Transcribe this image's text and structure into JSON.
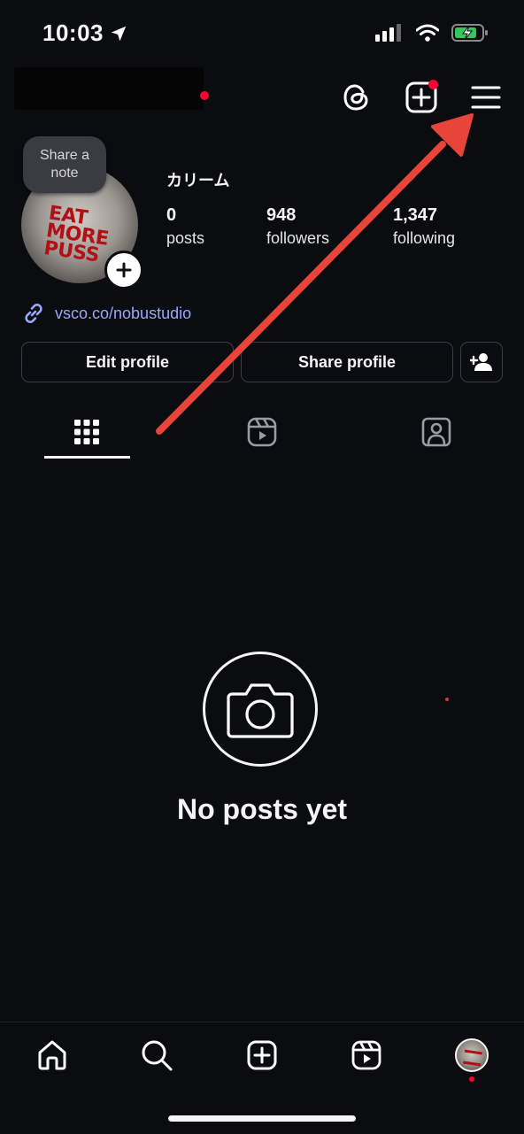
{
  "status_bar": {
    "time": "10:03",
    "icons": [
      "location-arrow-icon",
      "cellular-signal-icon",
      "wifi-icon",
      "battery-charging-icon"
    ]
  },
  "header": {
    "username": "",
    "icons": [
      "threads-icon",
      "create-icon",
      "menu-icon"
    ],
    "notification_color": "#ff0033"
  },
  "profile": {
    "note_bubble": [
      "Share a",
      "note"
    ],
    "avatar_text": [
      "EAT",
      "MORE",
      "PUSS"
    ],
    "display_name": "カリーム",
    "stats": [
      {
        "value": "0",
        "label": "posts"
      },
      {
        "value": "948",
        "label": "followers"
      },
      {
        "value": "1,347",
        "label": "following"
      }
    ],
    "link": "vsco.co/nobustudio",
    "buttons": {
      "edit": "Edit profile",
      "share": "Share profile"
    }
  },
  "tabs": [
    "grid-icon",
    "reels-icon",
    "tagged-icon"
  ],
  "empty_state": {
    "message": "No posts yet"
  },
  "bottom_nav": [
    "home-icon",
    "search-icon",
    "create-icon",
    "reels-icon",
    "profile-avatar"
  ],
  "colors": {
    "background": "#0b0c10",
    "link": "#9aa7ff",
    "accent_red": "#ff0033",
    "annotation_arrow": "#e8443a"
  }
}
